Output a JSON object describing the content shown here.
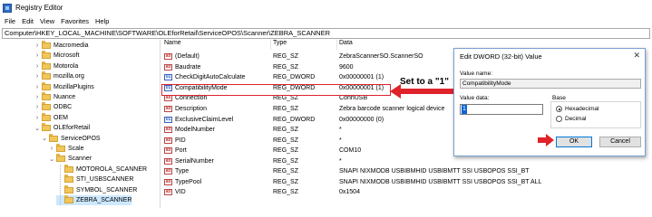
{
  "window": {
    "title": "Registry Editor"
  },
  "menu": [
    "File",
    "Edit",
    "View",
    "Favorites",
    "Help"
  ],
  "address": "Computer\\HKEY_LOCAL_MACHINE\\SOFTWARE\\OLEforRetail\\ServiceOPOS\\Scanner\\ZEBRA_SCANNER",
  "tree": [
    {
      "label": "Macromedia",
      "chevron": ">"
    },
    {
      "label": "Microsoft",
      "chevron": ">"
    },
    {
      "label": "Motorola",
      "chevron": ">"
    },
    {
      "label": "mozilla.org",
      "chevron": ">"
    },
    {
      "label": "MozillaPlugins",
      "chevron": ">"
    },
    {
      "label": "Nuance",
      "chevron": ">"
    },
    {
      "label": "ODBC",
      "chevron": ">"
    },
    {
      "label": "OEM",
      "chevron": ">"
    },
    {
      "label": "OLEforRetail",
      "chevron": "v"
    },
    {
      "label": "ServiceOPOS",
      "chevron": "v"
    },
    {
      "label": "Scale",
      "chevron": ">"
    },
    {
      "label": "Scanner",
      "chevron": "v"
    },
    {
      "label": "MOTOROLA_SCANNER",
      "chevron": ""
    },
    {
      "label": "STI_USBSCANNER",
      "chevron": ""
    },
    {
      "label": "SYMBOL_SCANNER",
      "chevron": ""
    },
    {
      "label": "ZEBRA_SCANNER",
      "chevron": "",
      "selected": true
    }
  ],
  "list": {
    "columns": {
      "name": "Name",
      "type": "Type",
      "data": "Data"
    },
    "rows": [
      {
        "icon": "ab",
        "name": "(Default)",
        "type": "REG_SZ",
        "data": "ZebraScannerSO.ScannerSO"
      },
      {
        "icon": "ab",
        "name": "Baudrate",
        "type": "REG_SZ",
        "data": "9600"
      },
      {
        "icon": "dw",
        "name": "CheckDigitAutoCalculate",
        "type": "REG_DWORD",
        "data": "0x00000001 (1)"
      },
      {
        "icon": "dw",
        "name": "CompatibilityMode",
        "type": "REG_DWORD",
        "data": "0x00000001 (1)"
      },
      {
        "icon": "ab",
        "name": "Connection",
        "type": "REG_SZ",
        "data": "ConnUSB"
      },
      {
        "icon": "ab",
        "name": "Description",
        "type": "REG_SZ",
        "data": "Zebra barcode scanner logical device"
      },
      {
        "icon": "dw",
        "name": "ExclusiveClaimLevel",
        "type": "REG_DWORD",
        "data": "0x00000000 (0)"
      },
      {
        "icon": "ab",
        "name": "ModelNumber",
        "type": "REG_SZ",
        "data": "*"
      },
      {
        "icon": "ab",
        "name": "PID",
        "type": "REG_SZ",
        "data": "*"
      },
      {
        "icon": "ab",
        "name": "Port",
        "type": "REG_SZ",
        "data": "COM10"
      },
      {
        "icon": "ab",
        "name": "SerialNumber",
        "type": "REG_SZ",
        "data": "*"
      },
      {
        "icon": "ab",
        "name": "Type",
        "type": "REG_SZ",
        "data": "SNAPI NIXMODB USBIBMHID USBIBMTT SSI USBOPOS SSI_BT"
      },
      {
        "icon": "ab",
        "name": "TypePool",
        "type": "REG_SZ",
        "data": "SNAPI NIXMODB USBIBMHID USBIBMTT SSI USBOPOS SSI_BT ALL"
      },
      {
        "icon": "ab",
        "name": "VID",
        "type": "REG_SZ",
        "data": "0x1504"
      }
    ]
  },
  "annotation": "Set to a \"1\"",
  "dialog": {
    "title": "Edit DWORD (32-bit) Value",
    "close": "✕",
    "value_name_label": "Value name:",
    "value_name": "CompatibilityMode",
    "value_data_label": "Value data:",
    "value_data": "1",
    "base_label": "Base",
    "hex_label": "Hexadecimal",
    "dec_label": "Decimal",
    "ok": "OK",
    "cancel": "Cancel"
  },
  "colors": {
    "highlight": "#e0222b",
    "selection": "#cce8ff",
    "accent": "#0078d7"
  }
}
